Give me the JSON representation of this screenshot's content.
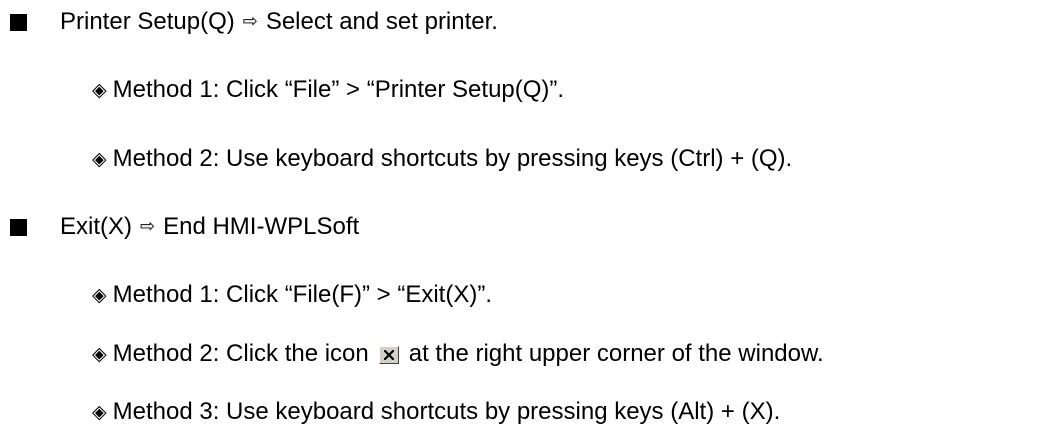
{
  "sections": [
    {
      "title": "Printer Setup(Q)",
      "description": "Select and set printer.",
      "methods": [
        {
          "label": "Method 1: Click “File” > “Printer Setup(Q)”."
        },
        {
          "label": "Method 2: Use keyboard shortcuts by pressing keys (Ctrl) + (Q)."
        }
      ]
    },
    {
      "title": "Exit(X)",
      "description": "End HMI-WPLSoft",
      "methods": [
        {
          "label": "Method 1: Click “File(F)” > “Exit(X)”."
        },
        {
          "label_before": "Method 2: Click the icon",
          "icon": "close-icon",
          "label_after": "at the right upper corner of the window."
        },
        {
          "label": "Method 3: Use keyboard shortcuts by pressing keys (Alt) + (X)."
        }
      ]
    }
  ],
  "glyphs": {
    "arrow": "⇨",
    "diamond": "◈"
  }
}
